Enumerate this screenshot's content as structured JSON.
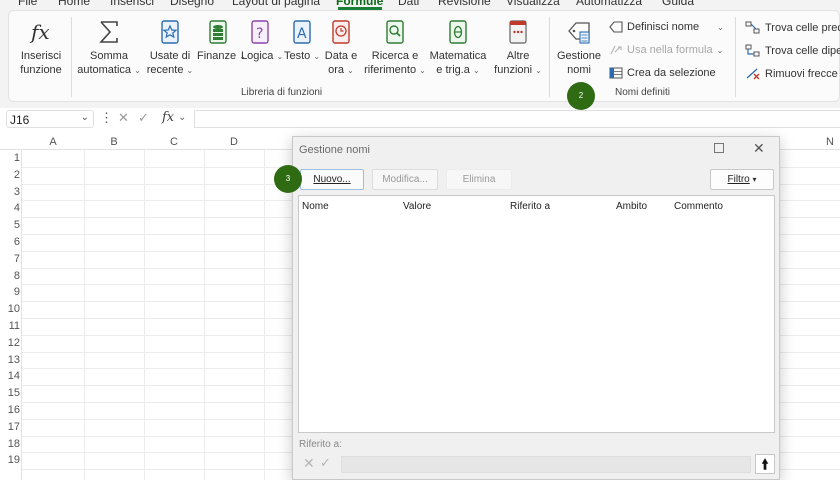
{
  "menu": {
    "tabs": [
      "File",
      "Home",
      "Inserisci",
      "Disegno",
      "Layout di pagina",
      "Formule",
      "Dati",
      "Revisione",
      "Visualizza",
      "Automatizza",
      "Guida"
    ],
    "active_tab": "Formule"
  },
  "ribbon": {
    "insert_function": [
      "Inserisci",
      "funzione"
    ],
    "library_buttons": [
      {
        "line1": "Somma",
        "line2": "automatica",
        "icon": "sigma-icon"
      },
      {
        "line1": "Usate di",
        "line2": "recente",
        "icon": "star-icon"
      },
      {
        "line1": "Finanze",
        "line2": "",
        "icon": "database-icon"
      },
      {
        "line1": "Logica",
        "line2": "",
        "icon": "question-book-icon"
      },
      {
        "line1": "Testo",
        "line2": "",
        "icon": "text-book-icon"
      },
      {
        "line1": "Data e",
        "line2": "ora",
        "icon": "clock-book-icon"
      },
      {
        "line1": "Ricerca e",
        "line2": "riferimento",
        "icon": "search-book-icon"
      },
      {
        "line1": "Matematica",
        "line2": "e trig.a",
        "icon": "theta-book-icon"
      },
      {
        "line1": "Altre",
        "line2": "funzioni",
        "icon": "more-book-icon"
      }
    ],
    "library_group_label": "Libreria di funzioni",
    "name_manager": [
      "Gestione",
      "nomi"
    ],
    "define_name": "Definisci nome",
    "use_in_formula": "Usa nella formula",
    "create_from_selection": "Crea da selezione",
    "names_group_label": "Nomi definiti",
    "trace_precedents": "Trova celle prece",
    "trace_dependents": "Trova celle diper",
    "remove_arrows": "Rimuovi frecce"
  },
  "formula_bar": {
    "name_box": "J16",
    "fx": "fx"
  },
  "grid": {
    "columns": [
      "A",
      "B",
      "C",
      "D",
      "N"
    ],
    "rows": [
      "1",
      "2",
      "3",
      "4",
      "5",
      "6",
      "7",
      "8",
      "9",
      "10",
      "11",
      "12",
      "13",
      "14",
      "15",
      "16",
      "17",
      "18",
      "19"
    ]
  },
  "dialog": {
    "title": "Gestione nomi",
    "buttons": {
      "new": "Nuovo...",
      "edit": "Modifica...",
      "delete": "Elimina",
      "filter": "Filtro"
    },
    "columns": [
      "Nome",
      "Valore",
      "Riferito a",
      "Ambito",
      "Commento"
    ],
    "refers_to_label": "Riferito a:"
  },
  "steps": {
    "two": "2",
    "three": "3"
  },
  "colors": {
    "accent": "#1a7f37",
    "step_bubble": "#2e6b12"
  }
}
